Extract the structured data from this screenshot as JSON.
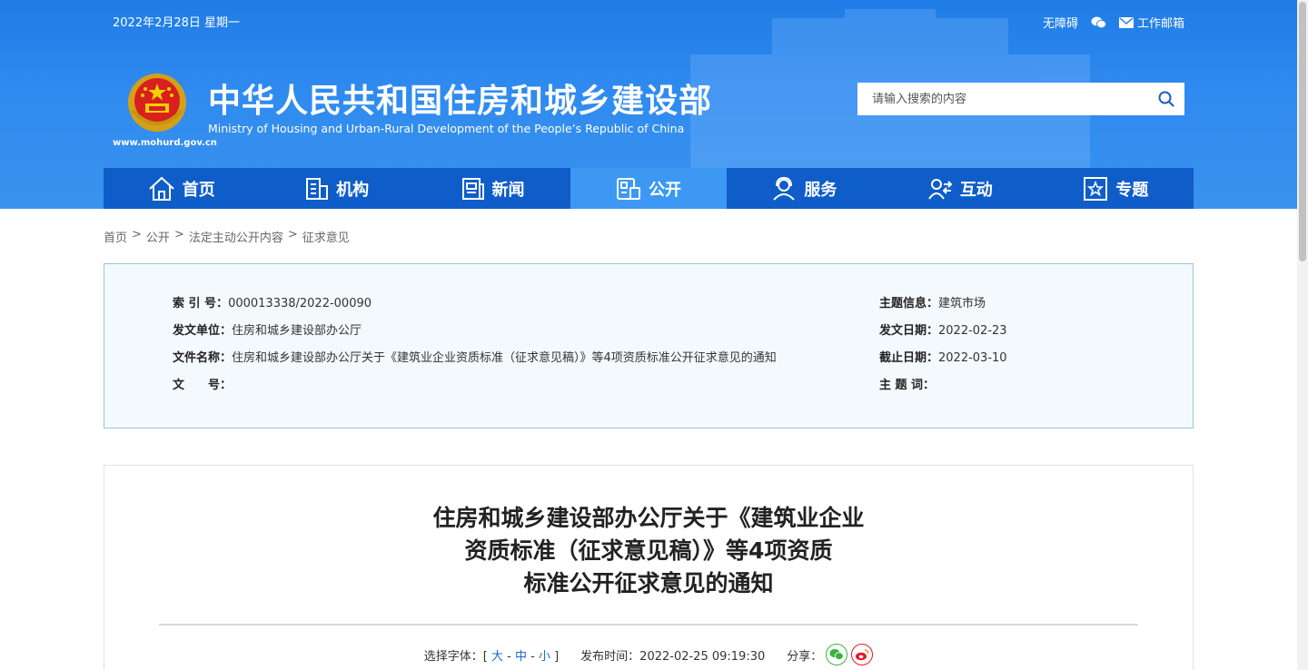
{
  "header": {
    "date": "2022年2月28日 星期一",
    "accessibility_label": "无障碍",
    "mail_label": "工作邮箱",
    "title": "中华人民共和国住房和城乡建设部",
    "subtitle": "Ministry of Housing and Urban-Rural Development of the People’s Republic of China",
    "site_url": "www.mohurd.gov.cn",
    "search_placeholder": "请输入搜索的内容"
  },
  "nav": [
    {
      "label": "首页",
      "icon": "home-icon"
    },
    {
      "label": "机构",
      "icon": "building-icon"
    },
    {
      "label": "新闻",
      "icon": "news-icon"
    },
    {
      "label": "公开",
      "icon": "public-info-icon",
      "active": true
    },
    {
      "label": "服务",
      "icon": "service-icon"
    },
    {
      "label": "互动",
      "icon": "interaction-icon"
    },
    {
      "label": "专题",
      "icon": "topic-icon"
    }
  ],
  "breadcrumb": [
    "首页",
    "公开",
    "法定主动公开内容",
    "征求意见"
  ],
  "info": {
    "index_label": "索 引 号：",
    "index_value": "000013338/2022-00090",
    "issuer_label": "发文单位：",
    "issuer_value": "住房和城乡建设部办公厅",
    "filename_label": "文件名称：",
    "filename_value": "住房和城乡建设部办公厅关于《建筑业企业资质标准（征求意见稿）》等4项资质标准公开征求意见的通知",
    "docno_label": "文　　号：",
    "docno_value": "",
    "topic_label": "主题信息：",
    "topic_value": "建筑市场",
    "issue_date_label": "发文日期：",
    "issue_date_value": "2022-02-23",
    "deadline_label": "截止日期：",
    "deadline_value": "2022-03-10",
    "keywords_label": "主 题 词：",
    "keywords_value": ""
  },
  "article": {
    "title_line1": "住房和城乡建设部办公厅关于《建筑业企业",
    "title_line2": "资质标准（征求意见稿）》等4项资质",
    "title_line3": "标准公开征求意见的通知",
    "font_select_label": "选择字体：[",
    "font_large": "大",
    "font_medium": "中",
    "font_small": "小",
    "font_close": "]",
    "publish_time_label": "发布时间：2022-02-25 09:19:30",
    "share_label": "分享："
  },
  "colors": {
    "header_blue": "#2f8bef",
    "nav_blue": "#0b58c4",
    "nav_active": "#3c98f2",
    "wechat_green": "#3db33d",
    "weibo_red": "#e6162d"
  }
}
